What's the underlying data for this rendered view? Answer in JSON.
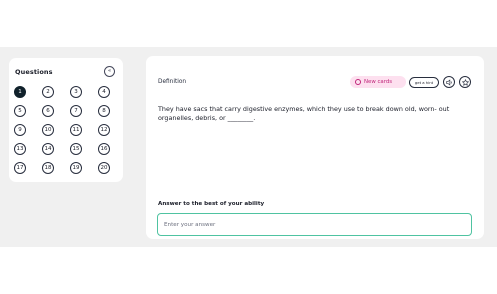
{
  "questions_panel": {
    "title": "Questions",
    "collapse_icon": "double-chevron-left-icon",
    "active_question": 1,
    "items": [
      {
        "label": "1"
      },
      {
        "label": "2"
      },
      {
        "label": "3"
      },
      {
        "label": "4"
      },
      {
        "label": "5"
      },
      {
        "label": "6"
      },
      {
        "label": "7"
      },
      {
        "label": "8"
      },
      {
        "label": "9"
      },
      {
        "label": "10"
      },
      {
        "label": "11"
      },
      {
        "label": "12"
      },
      {
        "label": "13"
      },
      {
        "label": "14"
      },
      {
        "label": "15"
      },
      {
        "label": "16"
      },
      {
        "label": "17"
      },
      {
        "label": "18"
      },
      {
        "label": "19"
      },
      {
        "label": "20"
      }
    ]
  },
  "card": {
    "label": "Definition",
    "badge": {
      "text": "New cards",
      "icon": "circle-icon",
      "color": "#c0257a",
      "background": "#fde0ef"
    },
    "hint_label": "get a hint",
    "audio_icon": "speaker-icon",
    "star_icon": "star-icon",
    "prompt": "They have sacs that carry digestive enzymes, which they use to break down old, worn- out organelles, debris, or ________.",
    "answer_label": "Answer to the best of your ability",
    "answer_placeholder": "Enter your answer",
    "answer_value": ""
  },
  "colors": {
    "active_question": "#10212b",
    "input_border": "#4fc3a1",
    "app_background": "#f0f0f0"
  }
}
